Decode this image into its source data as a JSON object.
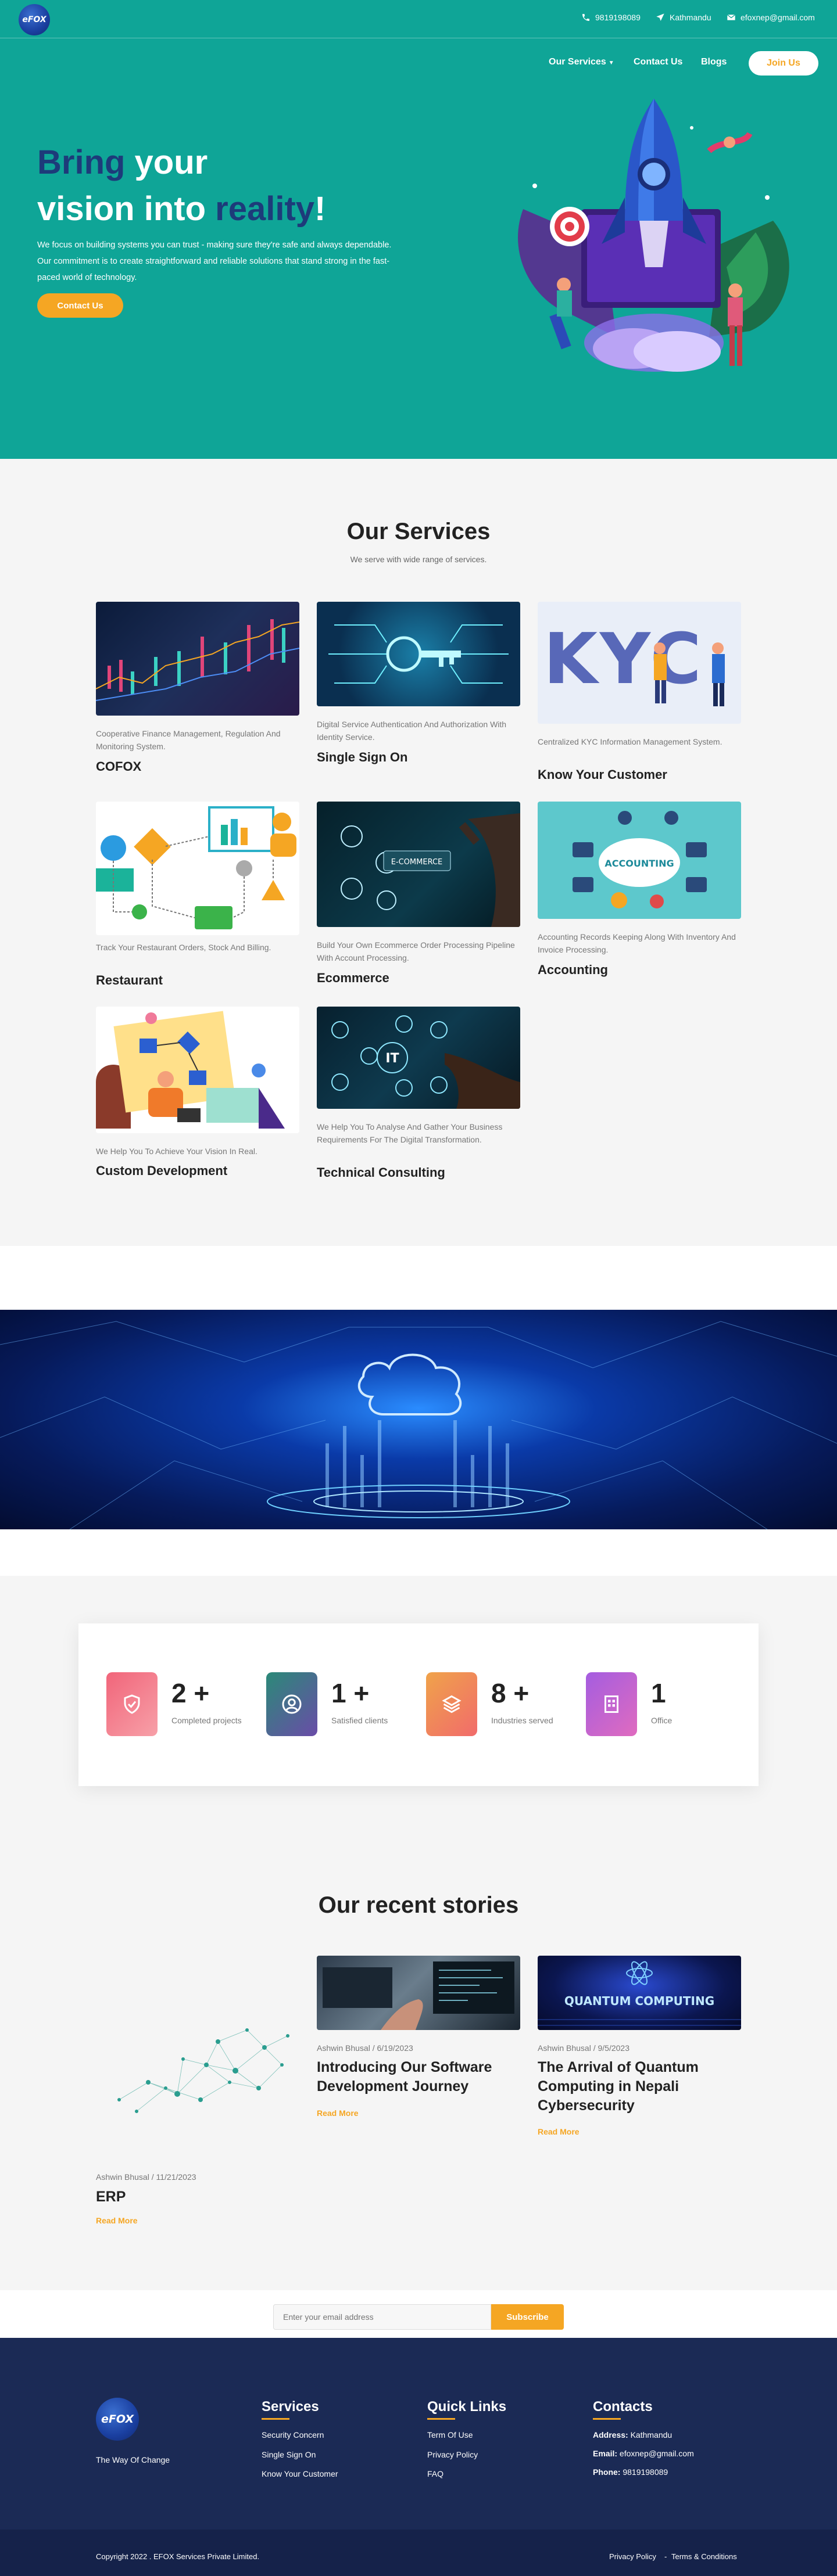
{
  "brand": {
    "logo_text": "eFOX",
    "tagline": "The Way Of Change"
  },
  "topbar": {
    "phone": "9819198089",
    "location": "Kathmandu",
    "email": "efoxnep@gmail.com"
  },
  "nav": {
    "services": "Our Services",
    "contact": "Contact Us",
    "blogs": "Blogs",
    "join": "Join Us"
  },
  "hero": {
    "title_line1_a": "Bring",
    "title_line1_b": " your",
    "title_line2_a": "vision into ",
    "title_line2_b": "reality",
    "title_line2_c": "!",
    "text": "We focus on building systems you can trust - making sure they're safe and always dependable. Our commitment is to create straightforward and reliable solutions that stand strong in the fast-paced world of technology.",
    "cta": "Contact Us"
  },
  "services": {
    "title": "Our Services",
    "subtitle": "We serve with wide range of services.",
    "items": [
      {
        "desc": "Cooperative Finance Management, Regulation And Monitoring System.",
        "title": "COFOX"
      },
      {
        "desc": "Digital Service Authentication And Authorization With Identity Service.",
        "title": "Single Sign On"
      },
      {
        "desc": "Centralized KYC Information Management System.",
        "title": "Know Your Customer",
        "img_text": "KYC"
      },
      {
        "desc": "Track Your Restaurant Orders, Stock And Billing.",
        "title": "Restaurant"
      },
      {
        "desc": "Build Your Own Ecommerce Order Processing Pipeline With Account Processing.",
        "title": "Ecommerce",
        "img_text": "E-COMMERCE"
      },
      {
        "desc": "Accounting Records Keeping Along With Inventory And Invoice Processing.",
        "title": "Accounting",
        "img_text": "ACCOUNTING"
      },
      {
        "desc": "We Help You To Achieve Your Vision In Real.",
        "title": "Custom Development"
      },
      {
        "desc": "We Help You To Analyse And Gather Your Business Requirements For The Digital Transformation.",
        "title": "Technical Consulting",
        "img_text": "IT"
      }
    ]
  },
  "stats": [
    {
      "num": "2 +",
      "label": "Completed projects",
      "icon": "shield-icon",
      "color_a": "#f1657a",
      "color_b": "#f7a0a8"
    },
    {
      "num": "1 +",
      "label": "Satisfied clients",
      "icon": "user-circle-icon",
      "color_a": "#2b8a78",
      "color_b": "#6a4ca8"
    },
    {
      "num": "8 +",
      "label": "Industries served",
      "icon": "layers-icon",
      "color_a": "#f0a34a",
      "color_b": "#f16b6b"
    },
    {
      "num": "1",
      "label": "Office",
      "icon": "building-icon",
      "color_a": "#a45de0",
      "color_b": "#e06bbf"
    }
  ],
  "stories": {
    "title": "Our recent stories",
    "items": [
      {
        "author": "Ashwin Bhusal",
        "date": "6/19/2023",
        "title": "Introducing Our Software Development Journey",
        "read": "Read More"
      },
      {
        "author": "Ashwin Bhusal",
        "date": "9/5/2023",
        "title": "The Arrival of Quantum Computing in Nepali Cybersecurity",
        "read": "Read More",
        "img_text": "QUANTUM COMPUTING"
      },
      {
        "author": "Ashwin Bhusal",
        "date": "11/21/2023",
        "title": "ERP",
        "read": "Read More"
      }
    ]
  },
  "newsletter": {
    "placeholder": "Enter your email address",
    "button": "Subscribe"
  },
  "footer": {
    "services_title": "Services",
    "services": [
      "Security Concern",
      "Single Sign On",
      "Know Your Customer"
    ],
    "links_title": "Quick Links",
    "links": [
      "Term Of Use",
      "Privacy Policy",
      "FAQ"
    ],
    "contacts_title": "Contacts",
    "address_label": "Address:",
    "address": "Kathmandu",
    "email_label": "Email:",
    "email": "efoxnep@gmail.com",
    "phone_label": "Phone:",
    "phone": "9819198089",
    "copyright": "Copyright 2022 . EFOX Services Private Limited.",
    "privacy": "Privacy Policy",
    "terms": "Terms & Conditions"
  }
}
